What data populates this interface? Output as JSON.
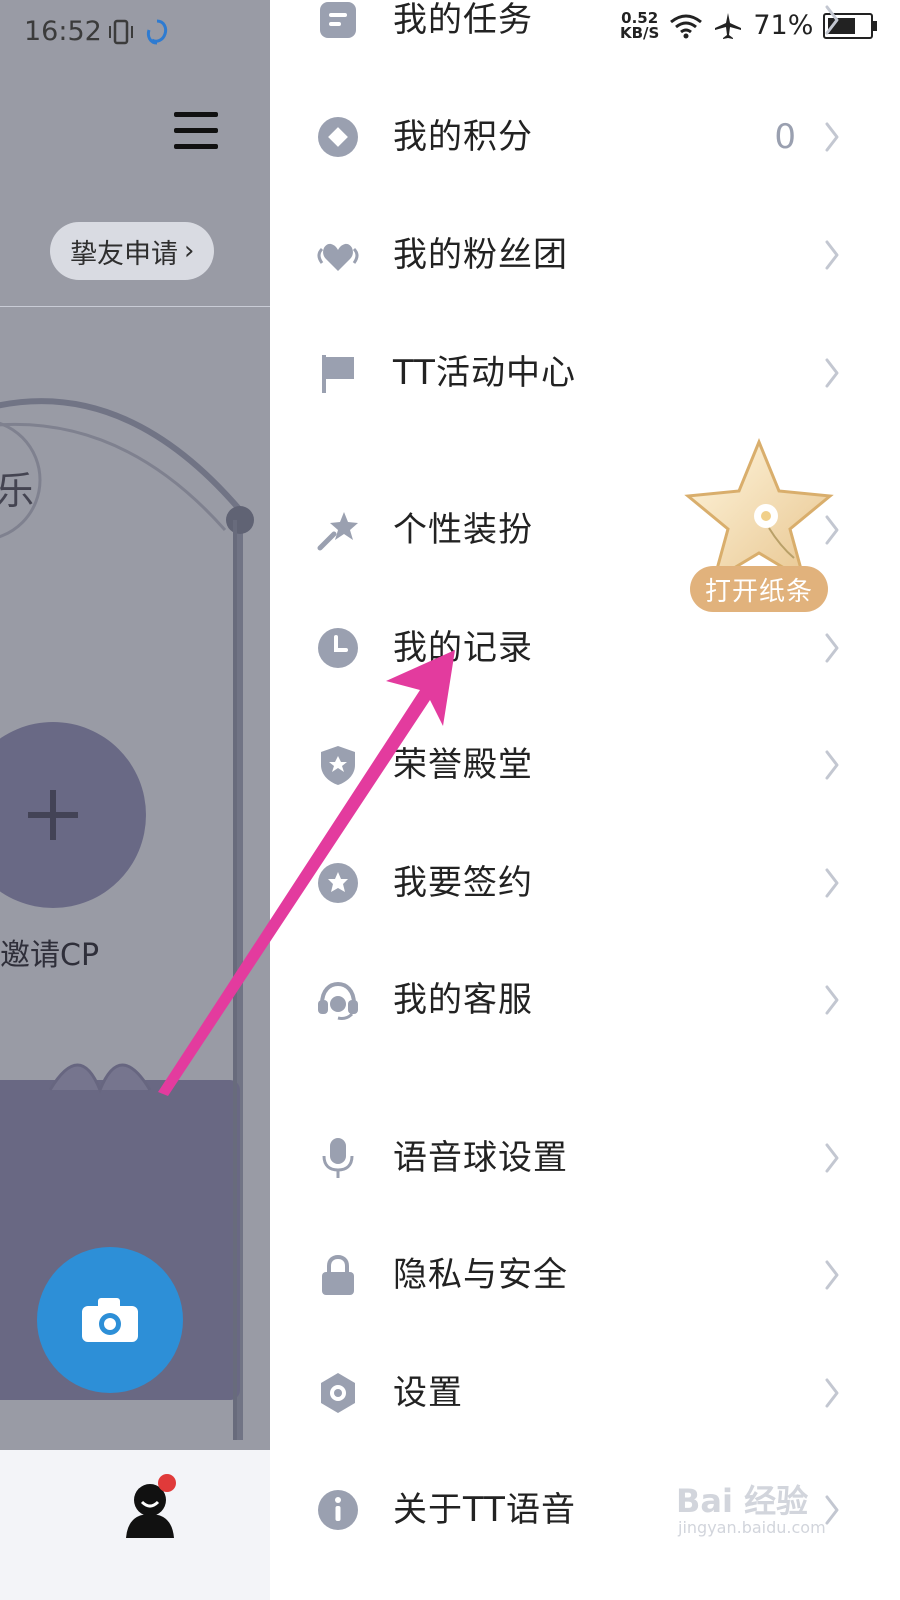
{
  "status_bar": {
    "time": "16:52",
    "net_speed_value": "0.52",
    "net_speed_unit": "KB/S",
    "battery_text": "71%",
    "battery_level": 0.71
  },
  "left_app": {
    "friend_request_label": "挚友申请",
    "invite_cp_label": "邀请CP",
    "partial_sign": "乐"
  },
  "drawer": {
    "items": [
      {
        "name": "my-tasks",
        "label": "我的任务",
        "icon": "task-icon",
        "value": ""
      },
      {
        "name": "my-points",
        "label": "我的积分",
        "icon": "points-icon",
        "value": "0"
      },
      {
        "name": "my-fan-group",
        "label": "我的粉丝团",
        "icon": "heart-wings-icon",
        "value": ""
      },
      {
        "name": "tt-activity-center",
        "label": "TT活动中心",
        "icon": "flag-icon",
        "value": ""
      },
      {
        "name": "personal-outfit",
        "label": "个性装扮",
        "icon": "magic-wand-icon",
        "value": ""
      },
      {
        "name": "my-records",
        "label": "我的记录",
        "icon": "clock-icon",
        "value": ""
      },
      {
        "name": "hall-of-honor",
        "label": "荣誉殿堂",
        "icon": "shield-star-icon",
        "value": ""
      },
      {
        "name": "sign-contract",
        "label": "我要签约",
        "icon": "star-circle-icon",
        "value": ""
      },
      {
        "name": "my-customer-service",
        "label": "我的客服",
        "icon": "headset-icon",
        "value": ""
      },
      {
        "name": "voice-ball-settings",
        "label": "语音球设置",
        "icon": "microphone-icon",
        "value": ""
      },
      {
        "name": "privacy-security",
        "label": "隐私与安全",
        "icon": "lock-icon",
        "value": ""
      },
      {
        "name": "settings",
        "label": "设置",
        "icon": "gear-icon",
        "value": ""
      },
      {
        "name": "about-tt",
        "label": "关于TT语音",
        "icon": "info-icon",
        "value": ""
      }
    ]
  },
  "star_float": {
    "button_label": "打开纸条",
    "icon": "star-icon"
  },
  "watermark": {
    "logo": "Bai 经验",
    "url": "jingyan.baidu.com"
  },
  "colors": {
    "icon_gray": "#9aa0b0",
    "text": "#222222",
    "chevron": "#c3c7d1",
    "arrow_pink": "#e33b9e",
    "fab_blue": "#2d8fd7"
  }
}
